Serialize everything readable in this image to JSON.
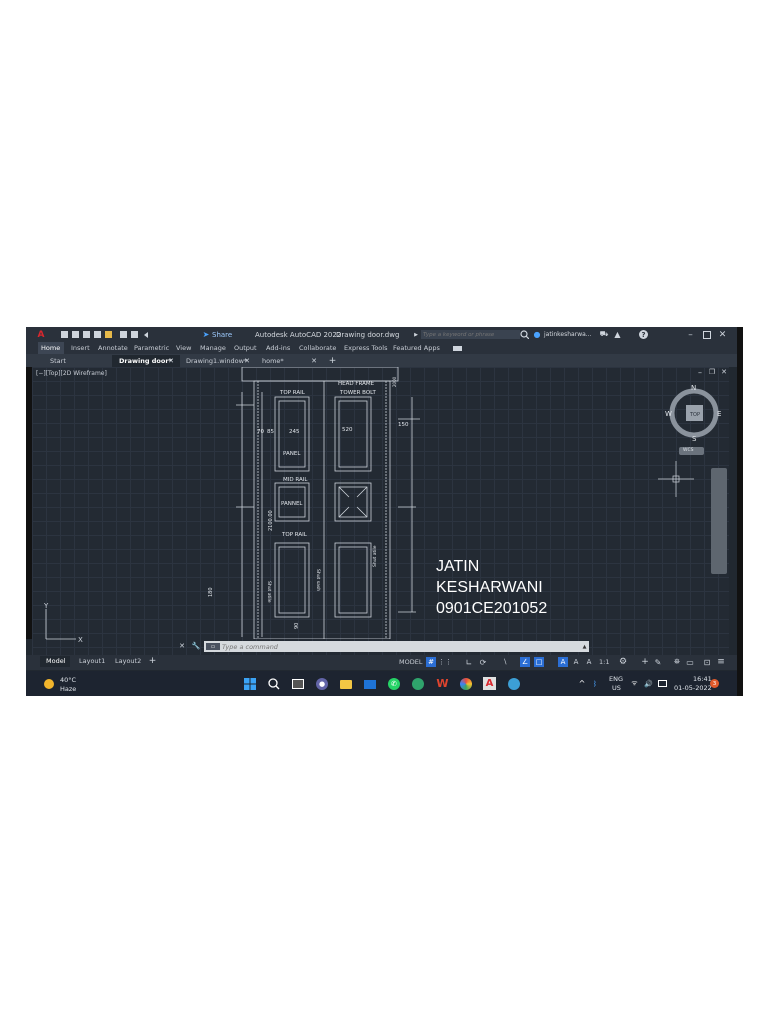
{
  "app": {
    "title": "Autodesk AutoCAD 2022",
    "document": "Drawing door.dwg",
    "search_placeholder": "Type a keyword or phrase",
    "user": "jatinkesharwa...",
    "share_label": "Share",
    "logo_letter": "A"
  },
  "ribbon_tabs": [
    "Home",
    "Insert",
    "Annotate",
    "Parametric",
    "View",
    "Manage",
    "Output",
    "Add-ins",
    "Collaborate",
    "Express Tools",
    "Featured Apps"
  ],
  "doc_tabs": [
    {
      "label": "Start"
    },
    {
      "label": "Drawing door*"
    },
    {
      "label": "Drawing1.window*"
    },
    {
      "label": "home*"
    }
  ],
  "viewport": {
    "label": "[−][Top][2D Wireframe]",
    "overlay_text": [
      "JATIN",
      "KESHARWANI",
      "0901CE201052"
    ],
    "viewcube": {
      "n": "N",
      "s": "S",
      "e": "E",
      "w": "W",
      "top": "TOP",
      "wcs": "WCS"
    },
    "ucs": {
      "y": "Y",
      "x": "X"
    }
  },
  "drawing": {
    "head_frame": "HEAD FRAME",
    "top_rail": "TOP RAIL",
    "tower_bolt": "TOWER BOLT",
    "panel": "PANEL",
    "mid_rail": "MID RAIL",
    "pannel": "PANNEL",
    "top_rail_2": "TOP RAIL",
    "dim_70": "70",
    "dim_85": "85",
    "dim_245": "245",
    "dim_520": "520",
    "dim_150": "150",
    "dim_2000": "2000",
    "dim_2100": "2100.00",
    "dim_180": "180",
    "dim_90": "90",
    "side_1": "Shut atile",
    "side_2": "Shut sash",
    "side_3": "Shut atile"
  },
  "command": {
    "placeholder": "Type a command"
  },
  "layout_tabs": [
    "Model",
    "Layout1",
    "Layout2"
  ],
  "status": {
    "model": "MODEL",
    "scale": "1:1"
  },
  "taskbar": {
    "weather_temp": "40°C",
    "weather_desc": "Haze",
    "lang_1": "ENG",
    "lang_2": "US",
    "time": "16:41",
    "date": "01-05-2022",
    "badge": "3"
  },
  "colors": {
    "accent": "#2b6ed4",
    "autocad_red": "#d9272e",
    "background": "#212830"
  }
}
